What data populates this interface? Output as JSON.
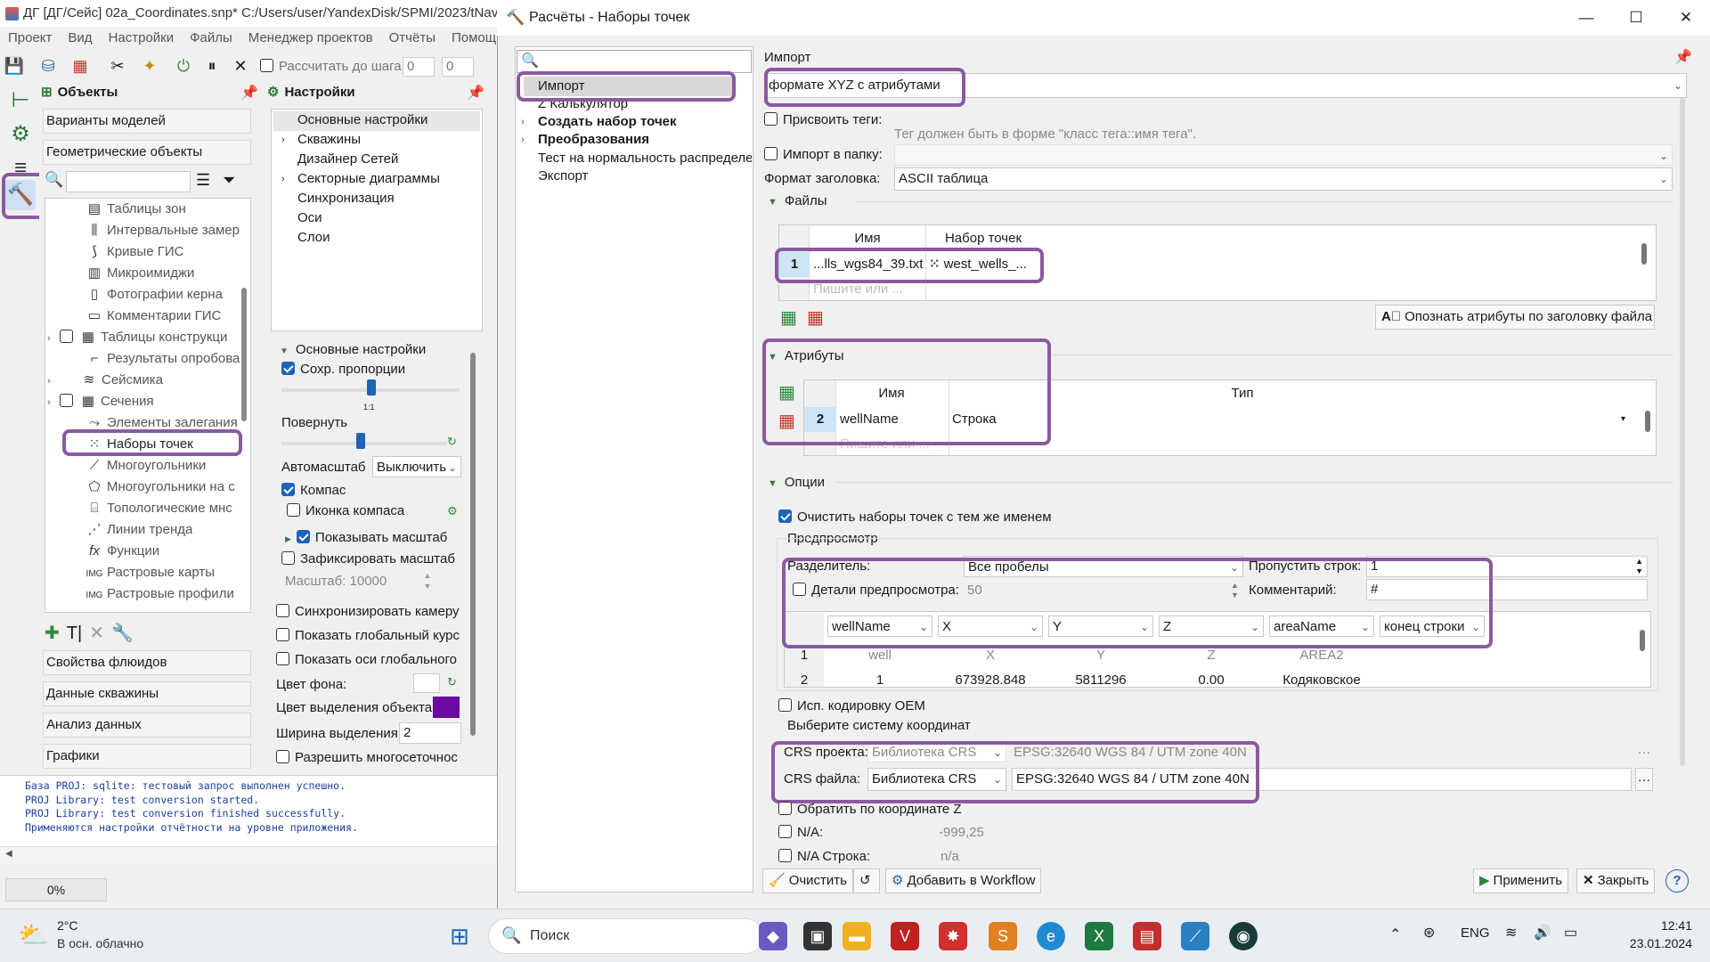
{
  "app": {
    "title": "ДГ [ДГ/Сейс] 02a_Coordinates.snp* C:/Users/user/YandexDisk/SPMI/2023/tNavP",
    "menu": [
      "Проект",
      "Вид",
      "Настройки",
      "Файлы",
      "Менеджер проектов",
      "Отчёты",
      "Помощь"
    ],
    "toolbar": {
      "calc_step_label": "Рассчитать до шага:",
      "step_value": "0",
      "step_value2": "0"
    },
    "objects_panel": {
      "title": "Объекты",
      "categories_top": [
        "Варианты моделей",
        "Геометрические объекты"
      ],
      "tree": [
        "Таблицы зон",
        "Интервальные замер",
        "Кривые ГИС",
        "Микроимиджи",
        "Фотографии керна",
        "Комментарии ГИС",
        "Таблицы конструкци",
        "Результаты опробова",
        "Сейсмика",
        "Сечения",
        "Элементы залегания",
        "Наборы точек",
        "Многоугольники",
        "Многоугольники на с",
        "Топологические мнс",
        "Линии тренда",
        "Функции",
        "Растровые карты",
        "Растровые профили"
      ],
      "categories_bottom": [
        "Свойства флюидов",
        "Данные скважины",
        "Анализ данных",
        "Графики"
      ]
    },
    "settings_panel": {
      "title": "Настройки",
      "tree": [
        "Основные настройки",
        "Скважины",
        "Дизайнер Сетей",
        "Секторные диаграммы",
        "Синхронизация",
        "Оси",
        "Слои"
      ],
      "section": "Основные настройки",
      "keep_proportions": "Сохр. пропорции",
      "ratio": "1:1",
      "rotate": "Повернуть",
      "autoscale_label": "Автомасштаб",
      "autoscale_value": "Выключить",
      "compass": "Компас",
      "compass_icon": "Иконка компаса",
      "show_scale": "Показывать масштаб",
      "fix_scale": "Зафиксировать масштаб",
      "scale_label": "Масштаб: 10000",
      "sync_camera": "Синхронизировать камеру",
      "show_global_course": "Показать глобальный курс",
      "show_global_axes": "Показать оси глобального",
      "bg_color": "Цвет фона:",
      "sel_color": "Цвет выделения объекта",
      "sel_width_label": "Ширина выделения",
      "sel_width_value": "2",
      "allow_multigrid": "Разрешить многосеточнос"
    },
    "log": [
      "База PROJ: sqlite: тестовый запрос выполнен успешно.",
      "PROJ Library: test conversion started.",
      "PROJ Library: test conversion finished successfully.",
      "Применяются настройки отчётности на уровне приложения."
    ],
    "progress": "0%"
  },
  "dialog": {
    "title": "Расчёты - Наборы точек",
    "tree": [
      "Импорт",
      "Z Калькулятор",
      "Создать набор точек",
      "Преобразования",
      "Тест на нормальность распределе",
      "Экспорт"
    ],
    "section_title": "Импорт",
    "format_value": "формате XYZ с атрибутами",
    "assign_tags": "Присвоить теги:",
    "tag_hint": "Тег должен быть в форме \"класс тега::имя тега\".",
    "import_folder": "Импорт в папку:",
    "header_format_label": "Формат заголовка:",
    "header_format_value": "ASCII таблица",
    "files_section": "Файлы",
    "files_cols": [
      "Имя",
      "Набор точек"
    ],
    "files_row": {
      "num": "1",
      "name": "...lls_wgs84_39.txt",
      "set": "west_wells_..."
    },
    "files_placeholder": "Пишите или ...",
    "recognize_btn": "Опознать атрибуты по заголовку файла",
    "attr_section": "Атрибуты",
    "attr_cols": [
      "Имя",
      "Тип"
    ],
    "attr_row": {
      "num": "2",
      "name": "wellName",
      "type": "Строка"
    },
    "attr_placeholder": "Пишите или ...",
    "options_section": "Опции",
    "clear_sets": "Очистить наборы точек с тем же именем",
    "preview_label": "Предпросмотр",
    "delimiter_label": "Разделитель:",
    "delimiter_value": "Все пробелы",
    "skip_rows_label": "Пропустить строк:",
    "skip_rows_value": "1",
    "preview_details": "Детали предпросмотра:",
    "preview_details_value": "50",
    "comment_label": "Комментарий:",
    "comment_value": "#",
    "preview_cols": [
      "wellName",
      "X",
      "Y",
      "Z",
      "areaName",
      "конец строки"
    ],
    "preview_rows": [
      [
        "1",
        "well",
        "X",
        "Y",
        "Z",
        "AREA2"
      ],
      [
        "2",
        "1",
        "673928.848",
        "5811296",
        "0.00",
        "Кодяковское"
      ]
    ],
    "oem": "Исп. кодировку OEM",
    "crs_section": "Выберите систему координат",
    "crs_project_label": "CRS проекта:",
    "crs_project_lib": "Библиотека CRS",
    "crs_project_value": "EPSG:32640 WGS 84 / UTM zone 40N",
    "crs_file_label": "CRS файла:",
    "crs_file_lib": "Библиотека CRS",
    "crs_file_value": "EPSG:32640 WGS 84 / UTM zone 40N",
    "invert_z": "Обратить по координате Z",
    "na_label": "N/A:",
    "na_value": "-999,25",
    "na_str_label": "N/A Строка:",
    "na_str_value": "n/a",
    "btn_clear": "Очистить",
    "btn_workflow": "Добавить в Workflow",
    "btn_apply": "Применить",
    "btn_close": "Закрыть"
  },
  "taskbar": {
    "weather_temp": "2°C",
    "weather_desc": "В осн. облачно",
    "search": "Поиск",
    "lang": "ENG",
    "time": "12:41",
    "date": "23.01.2024"
  },
  "colors": {
    "highlight": "#8a5aa0",
    "selection_color": "#6a0aa0",
    "accent": "#1e63b5"
  }
}
